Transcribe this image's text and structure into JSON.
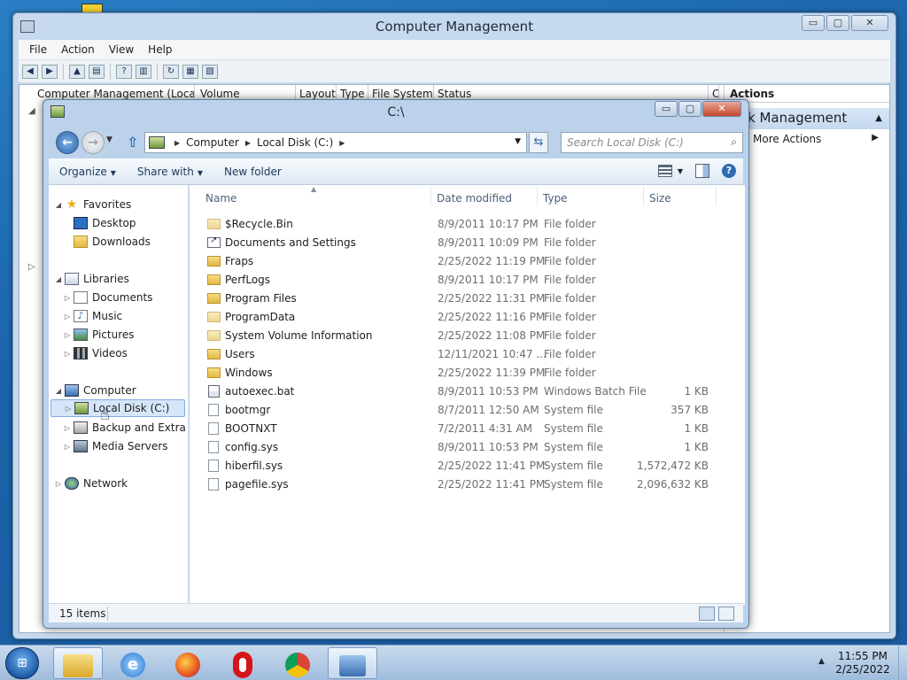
{
  "computer_management": {
    "title": "Computer Management",
    "controls": {
      "minimize": "▭",
      "maximize": "▢",
      "close": "✕"
    },
    "menus": [
      "File",
      "Action",
      "View",
      "Help"
    ],
    "tree_header": "Computer Management (Local",
    "columns": [
      "Volume",
      "Layout",
      "Type",
      "File System",
      "Status",
      "C"
    ],
    "actions": {
      "header": "Actions",
      "subheader": "k Management",
      "item": "More Actions"
    }
  },
  "explorer": {
    "title": "C:\\",
    "controls": {
      "minimize": "▭",
      "maximize": "▢",
      "close": "✕"
    },
    "breadcrumb": [
      "Computer",
      "Local Disk (C:)"
    ],
    "search_placeholder": "Search Local Disk (C:)",
    "commands": {
      "organize": "Organize",
      "share_with": "Share with",
      "new_folder": "New folder"
    },
    "nav": {
      "favorites": "Favorites",
      "desktop": "Desktop",
      "downloads": "Downloads",
      "libraries": "Libraries",
      "documents": "Documents",
      "music": "Music",
      "pictures": "Pictures",
      "videos": "Videos",
      "computer": "Computer",
      "local_disk": "Local Disk (C:)",
      "backup": "Backup and Extra Sto",
      "media_servers": "Media Servers",
      "network": "Network"
    },
    "column_headers": {
      "name": "Name",
      "date_modified": "Date modified",
      "type": "Type",
      "size": "Size"
    },
    "files": [
      {
        "name": "$Recycle.Bin",
        "date": "8/9/2011 10:17 PM",
        "type": "File folder",
        "size": "",
        "icon": "folder-sys"
      },
      {
        "name": "Documents and Settings",
        "date": "8/9/2011 10:09 PM",
        "type": "File folder",
        "size": "",
        "icon": "shortcut"
      },
      {
        "name": "Fraps",
        "date": "2/25/2022 11:19 PM",
        "type": "File folder",
        "size": "",
        "icon": "folder"
      },
      {
        "name": "PerfLogs",
        "date": "8/9/2011 10:17 PM",
        "type": "File folder",
        "size": "",
        "icon": "folder"
      },
      {
        "name": "Program Files",
        "date": "2/25/2022 11:31 PM",
        "type": "File folder",
        "size": "",
        "icon": "folder"
      },
      {
        "name": "ProgramData",
        "date": "2/25/2022 11:16 PM",
        "type": "File folder",
        "size": "",
        "icon": "folder-sys"
      },
      {
        "name": "System Volume Information",
        "date": "2/25/2022 11:08 PM",
        "type": "File folder",
        "size": "",
        "icon": "folder-sys"
      },
      {
        "name": "Users",
        "date": "12/11/2021 10:47 ...",
        "type": "File folder",
        "size": "",
        "icon": "folder"
      },
      {
        "name": "Windows",
        "date": "2/25/2022 11:39 PM",
        "type": "File folder",
        "size": "",
        "icon": "folder"
      },
      {
        "name": "autoexec.bat",
        "date": "8/9/2011 10:53 PM",
        "type": "Windows Batch File",
        "size": "1 KB",
        "icon": "bat"
      },
      {
        "name": "bootmgr",
        "date": "8/7/2011 12:50 AM",
        "type": "System file",
        "size": "357 KB",
        "icon": "file"
      },
      {
        "name": "BOOTNXT",
        "date": "7/2/2011 4:31 AM",
        "type": "System file",
        "size": "1 KB",
        "icon": "file"
      },
      {
        "name": "config.sys",
        "date": "8/9/2011 10:53 PM",
        "type": "System file",
        "size": "1 KB",
        "icon": "file"
      },
      {
        "name": "hiberfil.sys",
        "date": "2/25/2022 11:41 PM",
        "type": "System file",
        "size": "1,572,472 KB",
        "icon": "file"
      },
      {
        "name": "pagefile.sys",
        "date": "2/25/2022 11:41 PM",
        "type": "System file",
        "size": "2,096,632 KB",
        "icon": "file"
      }
    ],
    "status_count": "15 items"
  },
  "taskbar": {
    "apps": [
      "windows-explorer",
      "internet-explorer",
      "firefox",
      "opera",
      "chrome",
      "computer-management"
    ],
    "time": "11:55 PM",
    "date": "2/25/2022"
  },
  "colors": {
    "selection": "#d5e6f8",
    "accent": "#2d6bb3",
    "folder": "#e2b841"
  }
}
